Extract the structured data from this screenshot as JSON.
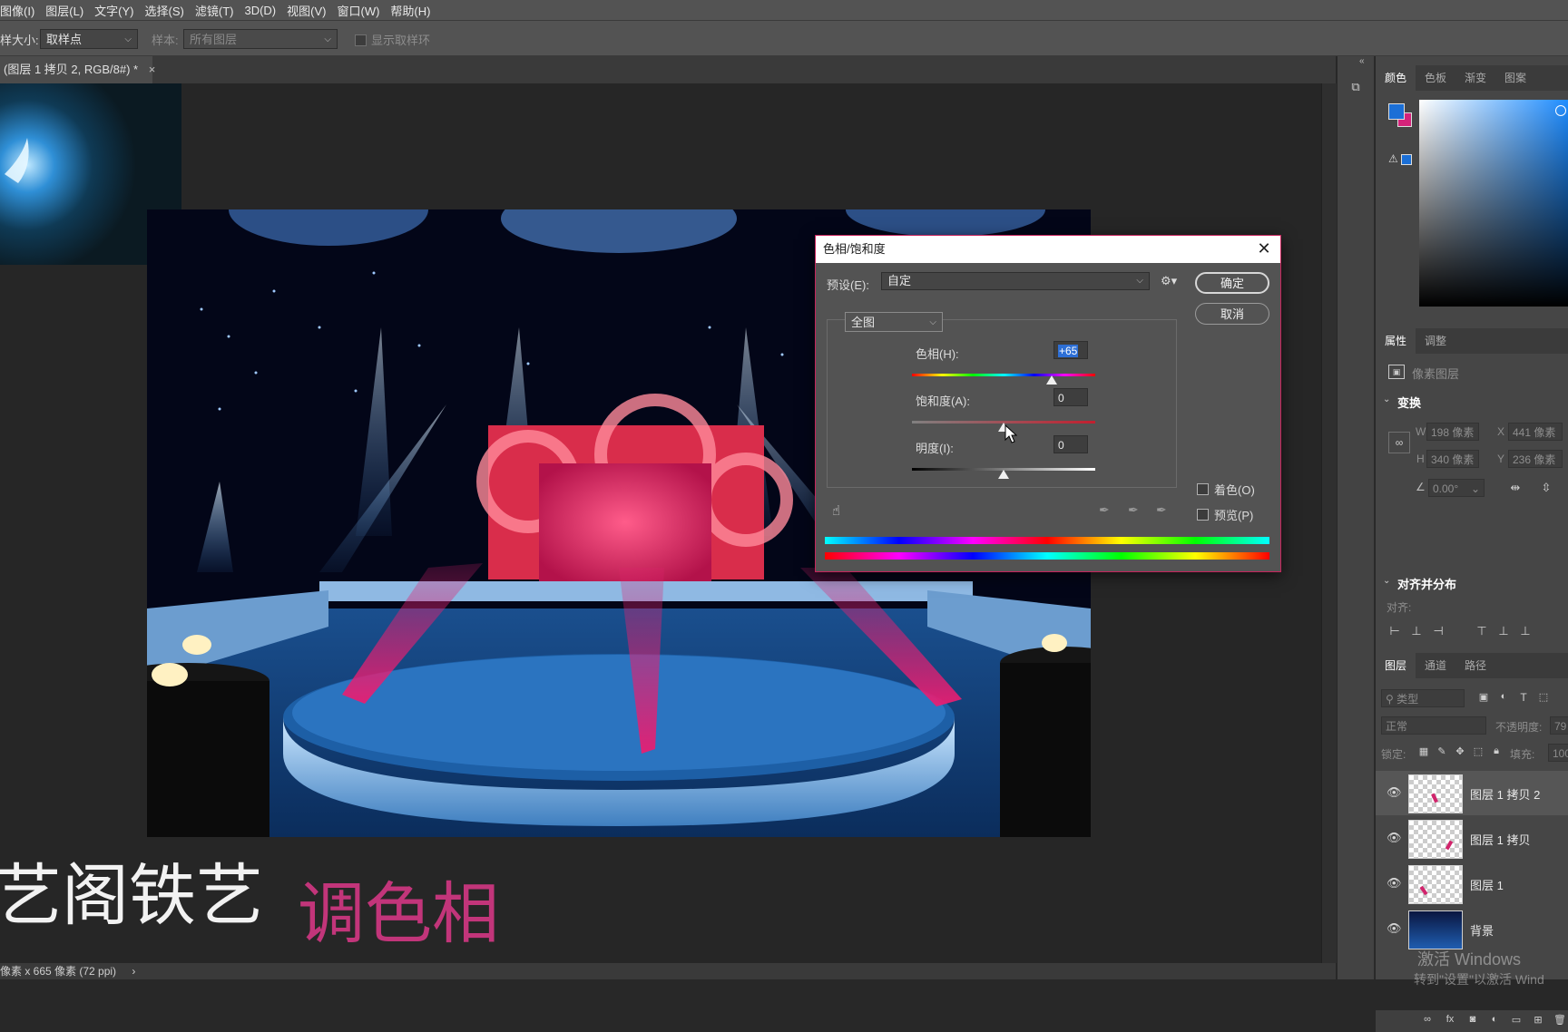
{
  "menubar": {
    "items": [
      "图像(I)",
      "图层(L)",
      "文字(Y)",
      "选择(S)",
      "滤镜(T)",
      "3D(D)",
      "视图(V)",
      "窗口(W)",
      "帮助(H)"
    ]
  },
  "options": {
    "sample_size_label": "样大小:",
    "sample_size_value": "取样点",
    "sample_label": "样本:",
    "sample_value": "所有图层",
    "show_ring_label": "显示取样环"
  },
  "document_tab": {
    "title": "(图层 1 拷贝 2, RGB/8#) *",
    "close": "×"
  },
  "status": {
    "text": "像素 x 665 像素 (72 ppi)",
    "arrow": "›"
  },
  "canvas_text": {
    "left_text": "艺阁铁艺",
    "hue_text": "调色相"
  },
  "color_panel": {
    "tabs": [
      "颜色",
      "色板",
      "渐变",
      "图案"
    ],
    "fg_color": "#1b6fd6",
    "bg_color": "#d4237a"
  },
  "properties_panel": {
    "tabs": [
      "属性",
      "调整"
    ],
    "layer_type": "像素图层",
    "transform_title": "变换",
    "w_label": "W",
    "w_value": "198 像素",
    "x_label": "X",
    "x_value": "441 像素",
    "h_label": "H",
    "h_value": "340 像素",
    "y_label": "Y",
    "y_value": "236 像素",
    "angle_value": "0.00°",
    "align_title": "对齐并分布",
    "align_label": "对齐:",
    "more": "..."
  },
  "layers_panel": {
    "tabs": [
      "图层",
      "通道",
      "路径"
    ],
    "filter_placeholder": "类型",
    "blend_mode": "正常",
    "opacity_label": "不透明度:",
    "opacity_value": "79",
    "lock_label": "锁定:",
    "fill_label": "填充:",
    "fill_value": "100",
    "layers": [
      {
        "name": "图层 1 拷贝 2",
        "selected": true
      },
      {
        "name": "图层 1 拷贝",
        "selected": false
      },
      {
        "name": "图层 1",
        "selected": false
      },
      {
        "name": "背景",
        "selected": false
      }
    ],
    "watermark_line1": "激活 Windows",
    "watermark_line2": "转到\"设置\"以激活 Wind"
  },
  "dialog": {
    "title": "色相/饱和度",
    "close": "✕",
    "preset_label": "预设(E):",
    "preset_value": "自定",
    "ok_label": "确定",
    "cancel_label": "取消",
    "channel_value": "全图",
    "hue_label": "色相(H):",
    "hue_value": "+65",
    "hue_level": 0.76,
    "saturation_label": "饱和度(A):",
    "saturation_value": "0",
    "saturation_level": 0.5,
    "lightness_label": "明度(I):",
    "lightness_value": "0",
    "lightness_level": 0.5,
    "colorize_label": "着色(O)",
    "preview_label": "预览(P)"
  }
}
